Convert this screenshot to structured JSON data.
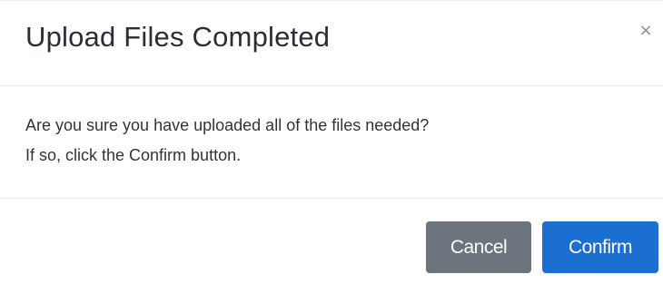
{
  "dialog": {
    "title": "Upload Files Completed",
    "close_symbol": "×",
    "body_lines": [
      "Are you sure you have uploaded all of the files needed?",
      "If so, click the Confirm button."
    ],
    "buttons": {
      "cancel_label": "Cancel",
      "confirm_label": "Confirm"
    }
  },
  "colors": {
    "cancel_button": "#6c757d",
    "confirm_button": "#1a6fd1",
    "title_text": "#2b2f33",
    "divider": "#e3e6ea"
  },
  "icons": {
    "close": "close-icon"
  }
}
